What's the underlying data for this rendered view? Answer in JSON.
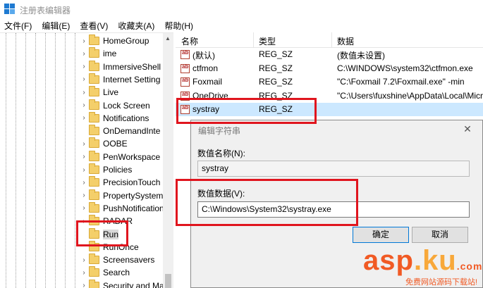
{
  "window": {
    "title": "注册表编辑器"
  },
  "menu": [
    "文件(F)",
    "编辑(E)",
    "查看(V)",
    "收藏夹(A)",
    "帮助(H)"
  ],
  "tree": {
    "items": [
      {
        "label": "HomeGroup",
        "expandable": true
      },
      {
        "label": "ime",
        "expandable": true
      },
      {
        "label": "ImmersiveShell",
        "expandable": true
      },
      {
        "label": "Internet Setting",
        "expandable": true
      },
      {
        "label": "Live",
        "expandable": true
      },
      {
        "label": "Lock Screen",
        "expandable": true
      },
      {
        "label": "Notifications",
        "expandable": true
      },
      {
        "label": "OnDemandInte",
        "expandable": false
      },
      {
        "label": "OOBE",
        "expandable": true
      },
      {
        "label": "PenWorkspace",
        "expandable": true
      },
      {
        "label": "Policies",
        "expandable": true
      },
      {
        "label": "PrecisionTouch",
        "expandable": true
      },
      {
        "label": "PropertySystem",
        "expandable": true
      },
      {
        "label": "PushNotification",
        "expandable": true
      },
      {
        "label": "RADAR",
        "expandable": true
      },
      {
        "label": "Run",
        "expandable": false,
        "selected": true
      },
      {
        "label": "RunOnce",
        "expandable": false
      },
      {
        "label": "Screensavers",
        "expandable": true
      },
      {
        "label": "Search",
        "expandable": true
      },
      {
        "label": "Security and Ma",
        "expandable": true
      }
    ]
  },
  "list": {
    "headers": {
      "name": "名称",
      "type": "类型",
      "data": "数据"
    },
    "rows": [
      {
        "name": "(默认)",
        "type": "REG_SZ",
        "data": "(数值未设置)"
      },
      {
        "name": "ctfmon",
        "type": "REG_SZ",
        "data": "C:\\WINDOWS\\system32\\ctfmon.exe"
      },
      {
        "name": "Foxmail",
        "type": "REG_SZ",
        "data": "\"C:\\Foxmail 7.2\\Foxmail.exe\" -min"
      },
      {
        "name": "OneDrive",
        "type": "REG_SZ",
        "data": "\"C:\\Users\\fuxshine\\AppData\\Local\\Micr"
      },
      {
        "name": "systray",
        "type": "REG_SZ",
        "data": "",
        "selected": true
      }
    ]
  },
  "dialog": {
    "title": "编辑字符串",
    "name_label": "数值名称(N):",
    "name_value": "systray",
    "data_label": "数值数据(V):",
    "data_value": "C:\\Windows\\System32\\systray.exe",
    "ok_label": "确定",
    "cancel_label": "取消",
    "close_glyph": "✕"
  },
  "watermark": {
    "brand_a": "asp",
    "brand_dot": ".",
    "brand_b": "ku",
    "brand_c": ".com",
    "tagline": "免费网站源码下载站!"
  },
  "colors": {
    "highlight": "#e0151e",
    "selection": "#cce8ff",
    "accent": "#0078d7"
  }
}
